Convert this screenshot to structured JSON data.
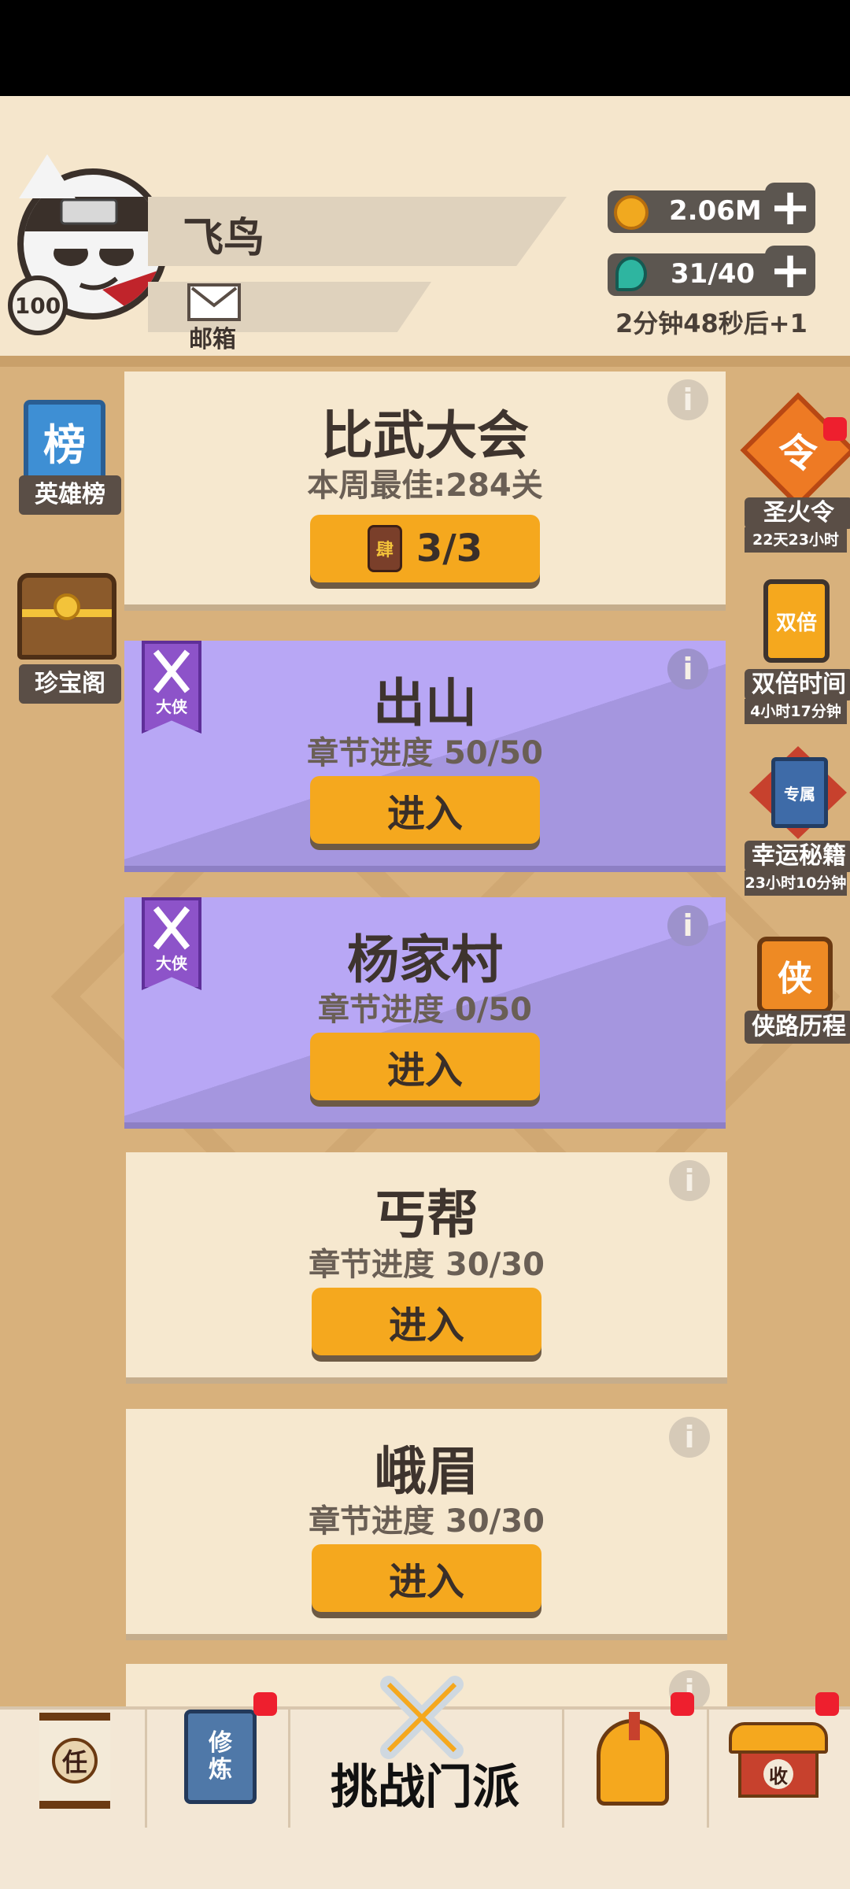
{
  "player": {
    "name": "飞鸟",
    "level": "100",
    "mail_label": "邮箱"
  },
  "resources": {
    "coins": "2.06M",
    "energy": "31/40",
    "regen_timer": "2分钟48秒后+1",
    "plus": "+"
  },
  "left_menu": {
    "ranking_icon_text": "榜",
    "ranking_label": "英雄榜",
    "treasure_label": "珍宝阁"
  },
  "right_menu": {
    "token_icon_text": "令",
    "token_label": "圣火令",
    "token_timer": "22天23小时",
    "double_icon_text": "双倍",
    "double_label": "双倍时间",
    "double_timer": "4小时17分钟",
    "secret_icon_text": "专属",
    "secret_label": "幸运秘籍",
    "secret_timer": "23小时10分钟",
    "journey_icon_text": "侠",
    "journey_label": "侠路历程"
  },
  "arena": {
    "title": "比武大会",
    "best": "本周最佳:284关",
    "ticket_icon_text": "肆",
    "tickets": "3/3"
  },
  "chapters": [
    {
      "title": "出山",
      "progress": "章节进度 50/50",
      "badge": "大侠",
      "button": "进入"
    },
    {
      "title": "杨家村",
      "progress": "章节进度 0/50",
      "badge": "大侠",
      "button": "进入"
    },
    {
      "title": "丐帮",
      "progress": "章节进度 30/30",
      "button": "进入"
    },
    {
      "title": "峨眉",
      "progress": "章节进度 30/30",
      "button": "进入"
    }
  ],
  "info_glyph": "i",
  "bottom_nav": {
    "task_icon_text": "任",
    "cultivate_icon_text": "修炼",
    "challenge_label": "挑战门派",
    "collect_icon_text": "收"
  },
  "colors": {
    "button": "#f5a81e",
    "card": "#f6e8cf",
    "purple_card": "#b8a7f5",
    "badge": "#ee1f2e"
  }
}
